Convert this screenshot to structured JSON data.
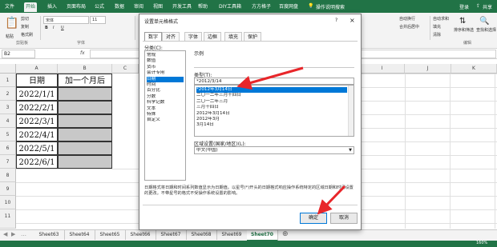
{
  "ribbon_tabs": [
    "文件",
    "开始",
    "插入",
    "页面布局",
    "公式",
    "数据",
    "审阅",
    "视图",
    "开发工具",
    "帮助",
    "DIY工具箱",
    "方方格子",
    "百度网盘"
  ],
  "ribbon_active_tab": "开始",
  "search_placeholder": "操作说明搜索",
  "user": {
    "login": "登录",
    "share": "共享"
  },
  "ribbon": {
    "cut": "剪切",
    "copy": "复制",
    "format_painter": "格式刷",
    "paste": "粘贴",
    "font_name": "宋体",
    "font_size": "11",
    "font_group": "字体",
    "wrap": "自动换行",
    "merge": "合并后居中",
    "sum": "自动求和",
    "fill": "填充",
    "clear": "清除",
    "sort_filter": "排序和筛选",
    "find_select": "查找和选择",
    "editing": "编辑",
    "clipboard": "剪贴板"
  },
  "formula_bar": {
    "name_box": "B2",
    "fx": "fx"
  },
  "grid": {
    "columns": [
      "A",
      "B",
      "C",
      "D",
      "E",
      "F",
      "G",
      "H",
      "I",
      "J",
      "K"
    ],
    "row_numbers": [
      "1",
      "2",
      "3",
      "4",
      "5",
      "6",
      "7",
      "8",
      "9",
      "10",
      "11"
    ],
    "header_a": "日期",
    "header_b": "加一个月后",
    "dates": [
      "2022/1/1",
      "2022/2/1",
      "2022/3/1",
      "2022/4/1",
      "2022/5/1",
      "2022/6/1"
    ]
  },
  "sheet_tabs": [
    "Sheet63",
    "Sheet64",
    "Sheet65",
    "Sheet66",
    "Sheet67",
    "Sheet68",
    "Sheet69",
    "Sheet70"
  ],
  "active_sheet": "Sheet70",
  "zoom": "160%",
  "dialog": {
    "title": "设置单元格格式",
    "help": "?",
    "close": "×",
    "tabs": [
      "数字",
      "对齐",
      "字体",
      "边框",
      "填充",
      "保护"
    ],
    "active_tab": "数字",
    "category_label": "分类(C):",
    "categories": [
      "常规",
      "数值",
      "货币",
      "会计专用",
      "日期",
      "时间",
      "百分比",
      "分数",
      "科学记数",
      "文本",
      "特殊",
      "自定义"
    ],
    "selected_category": "日期",
    "sample_label": "示例",
    "type_label": "类型(T):",
    "types": [
      "*2012/3/14",
      "*2012年3月14日",
      "二〇一二年三月十四日",
      "二〇一二年三月",
      "三月十四日",
      "2012年3月14日",
      "2012年3月",
      "3月14日"
    ],
    "selected_type": "*2012年3月14日",
    "locale_label": "区域设置(国家/地区)(L):",
    "locale_value": "中文(中国)",
    "description": "日期格式将日期和时间系列数值显示为日期值。以星号(*)开头的日期格式响应操作系统特定的区域日期和时间设置的更改。不带星号的格式不受操作系统设置的影响。",
    "ok": "确定",
    "cancel": "取消"
  },
  "colors": {
    "excel_green": "#217346",
    "selection_blue": "#0078d7",
    "arrow_red": "#e8262a"
  }
}
